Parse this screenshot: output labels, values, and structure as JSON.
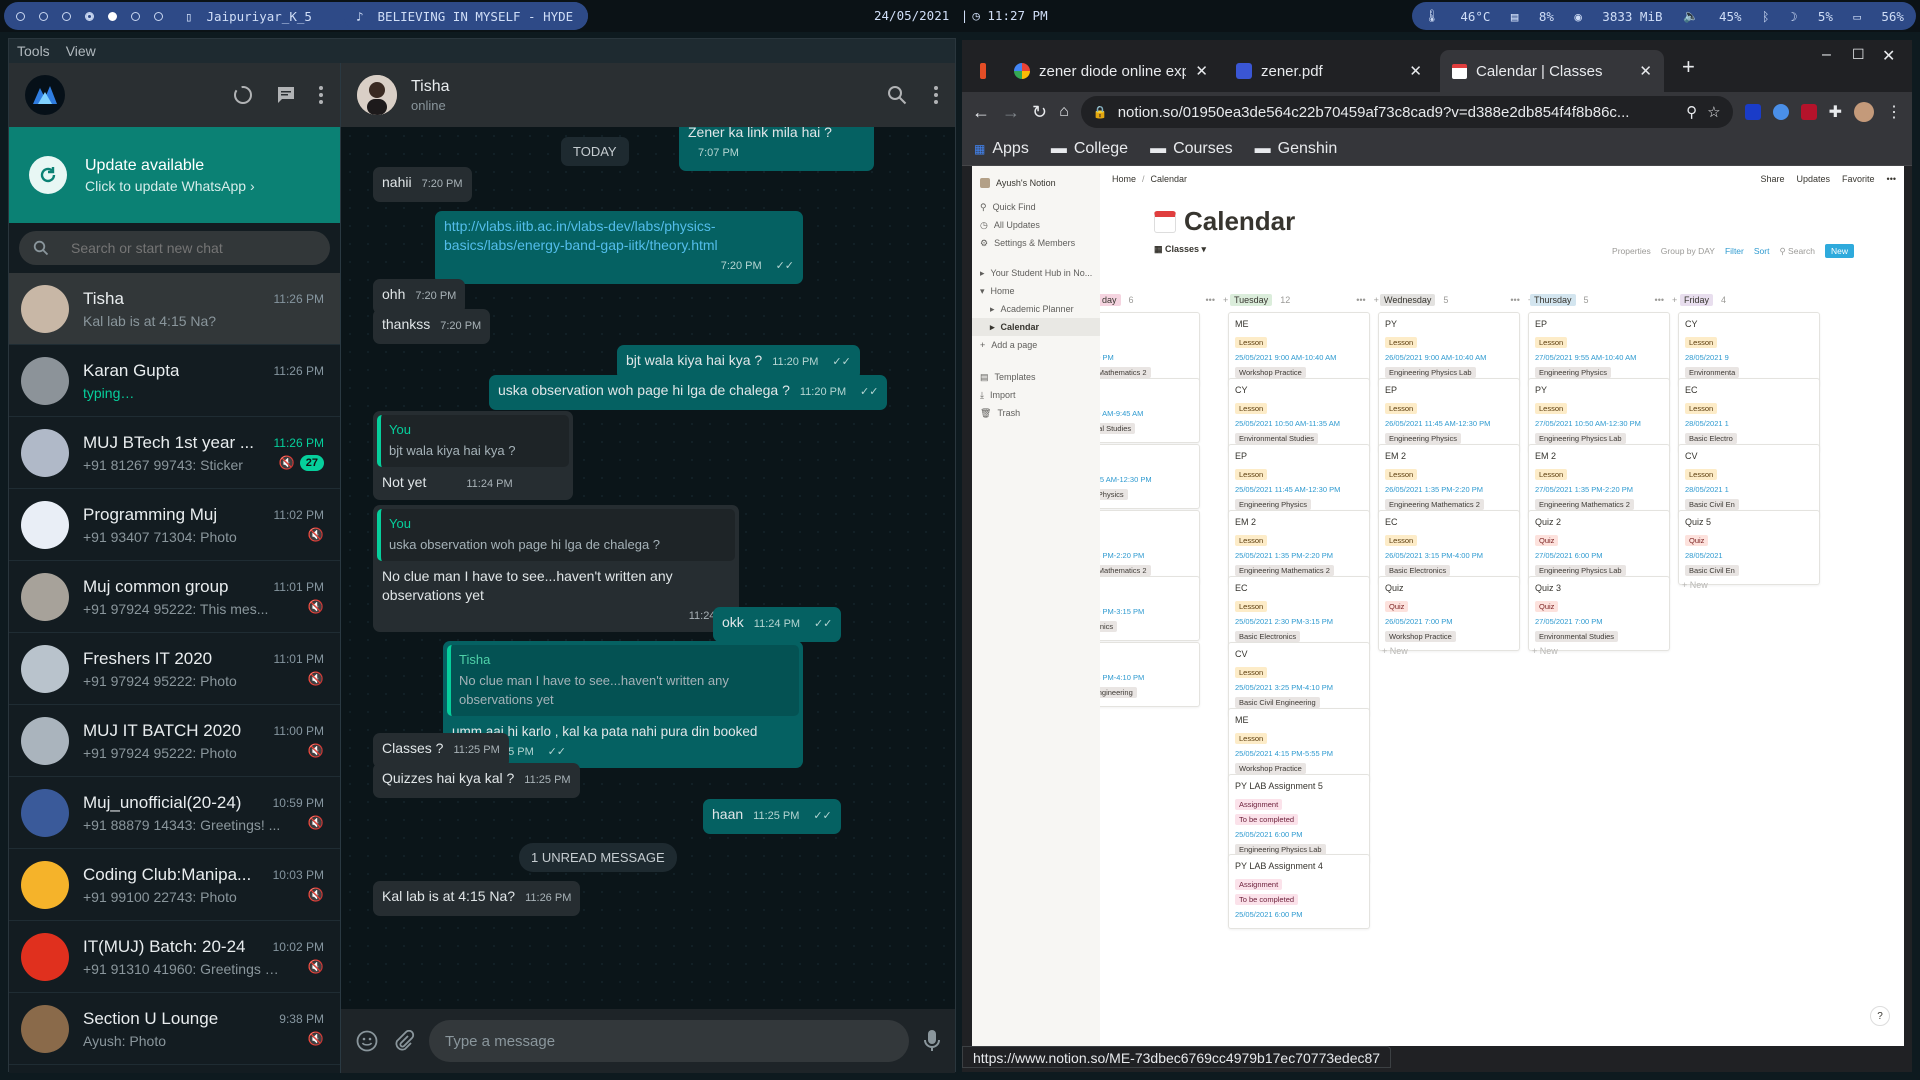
{
  "topbar": {
    "workspace_window": "Jaipuriyar_K_5",
    "now_playing": "BELIEVING IN MYSELF - HYDE",
    "date": "24/05/2021",
    "time": "11:27 PM",
    "temp": "46°C",
    "cpu": "8%",
    "mem": "3833 MiB",
    "volume": "45%",
    "brightness": "5%",
    "battery": "56%"
  },
  "whatsapp": {
    "menu": [
      "Tools",
      "View"
    ],
    "update": {
      "title": "Update available",
      "subtitle": "Click to update WhatsApp ›"
    },
    "search_placeholder": "Search or start new chat",
    "chats": [
      {
        "name": "Tisha",
        "time": "11:26 PM",
        "msg": "Kal lab is at 4:15 Na?",
        "active": true
      },
      {
        "name": "Karan Gupta",
        "time": "11:26 PM",
        "msg": "typing…",
        "typing": true
      },
      {
        "name": "MUJ BTech 1st year ...",
        "time": "11:26 PM",
        "msg": "+91 81267 99743: Sticker",
        "badge": "27"
      },
      {
        "name": "Programming Muj",
        "time": "11:02 PM",
        "msg": "+91 93407 71304: Photo"
      },
      {
        "name": "Muj common group",
        "time": "11:01 PM",
        "msg": "+91 97924 95222: This mes..."
      },
      {
        "name": "Freshers IT 2020",
        "time": "11:01 PM",
        "msg": "+91 97924 95222: Photo"
      },
      {
        "name": "MUJ IT BATCH 2020",
        "time": "11:00 PM",
        "msg": "+91 97924 95222: Photo"
      },
      {
        "name": "Muj_unofficial(20-24)",
        "time": "10:59 PM",
        "msg": "+91 88879 14343: Greetings! ..."
      },
      {
        "name": "Coding Club:Manipa...",
        "time": "10:03 PM",
        "msg": "+91 99100 22743: Photo"
      },
      {
        "name": "IT(MUJ) Batch: 20-24",
        "time": "10:02 PM",
        "msg": "+91 91310 41960: Greetings M..."
      },
      {
        "name": "Section U Lounge",
        "time": "9:38 PM",
        "msg": "Ayush: Photo"
      }
    ],
    "conversation": {
      "name": "Tisha",
      "status": "online",
      "top_partial": "Zener ka link mila hai ?",
      "top_partial_time": "7:07 PM",
      "today": "TODAY",
      "m1": {
        "text": "nahii",
        "time": "7:20 PM"
      },
      "m2": {
        "text": "http://vlabs.iitb.ac.in/vlabs-dev/labs/physics-basics/labs/energy-band-gap-iitk/theory.html",
        "time": "7:20 PM"
      },
      "m3": {
        "text": "ohh",
        "time": "7:20 PM"
      },
      "m4": {
        "text": "thankss",
        "time": "7:20 PM"
      },
      "m5": {
        "text": "bjt wala kiya hai kya ?",
        "time": "11:20 PM"
      },
      "m6": {
        "text": "uska observation woh page hi lga de chalega ?",
        "time": "11:20 PM"
      },
      "m7": {
        "quote_name": "You",
        "quote_text": "bjt wala kiya hai kya ?",
        "text": "Not yet",
        "time": "11:24 PM"
      },
      "m8": {
        "quote_name": "You",
        "quote_text": "uska observation woh page hi lga de chalega ?",
        "text": "No clue man I have to see...haven't written any observations yet",
        "time": "11:24 PM"
      },
      "m9": {
        "text": "okk",
        "time": "11:24 PM"
      },
      "m10": {
        "quote_name": "Tisha",
        "quote_text": "No clue man I have to see...haven't written any observations yet",
        "text": "umm aaj hi karlo , kal ka pata nahi pura din booked hain",
        "time": "11:25 PM"
      },
      "m11": {
        "text": "Classes ?",
        "time": "11:25 PM"
      },
      "m12": {
        "text": "Quizzes hai kya kal ?",
        "time": "11:25 PM"
      },
      "m13": {
        "text": "haan",
        "time": "11:25 PM"
      },
      "unread": "1 UNREAD MESSAGE",
      "m14": {
        "text": "Kal lab is at 4:15 Na?",
        "time": "11:26 PM"
      },
      "input_placeholder": "Type a message"
    }
  },
  "browser": {
    "tabs": [
      "zener diode online exper",
      "zener.pdf",
      "Calendar | Classes"
    ],
    "url": "notion.so/01950ea3de564c22b70459af73c8cad9?v=d388e2db854f4f8b86c...",
    "bookmarks": [
      "Apps",
      "College",
      "Courses",
      "Genshin"
    ],
    "status_url": "https://www.notion.so/ME-73dbec6769cc4979b17ec70773edec87"
  },
  "notion": {
    "workspace": "Ayush's Notion",
    "side_items": [
      "Quick Find",
      "All Updates",
      "Settings & Members"
    ],
    "pages": [
      "Your Student Hub in No...",
      "Home",
      "Academic Planner",
      "Calendar",
      "Add a page"
    ],
    "bottom": [
      "Templates",
      "Import",
      "Trash"
    ],
    "breadcrumb": [
      "Home",
      "Calendar"
    ],
    "actions": [
      "Share",
      "Updates",
      "Favorite"
    ],
    "title": "Calendar",
    "view": "Classes",
    "controls": [
      "Properties",
      "Group by DAY",
      "Filter",
      "Sort",
      "Search",
      "New"
    ],
    "columns": [
      {
        "label": "day",
        "count": "6",
        "color": "#f5d4e0"
      },
      {
        "label": "Tuesday",
        "count": "12",
        "color": "#dbeddb"
      },
      {
        "label": "Wednesday",
        "count": "5",
        "color": "#e3e2e0"
      },
      {
        "label": "Thursday",
        "count": "5",
        "color": "#d3e5ef"
      },
      {
        "label": "Friday",
        "count": "4",
        "color": "#e8deee"
      }
    ],
    "col0": [
      {
        "t": "2",
        "tag": "Quiz",
        "date": "/2021 7:30 PM",
        "sub": "ineering Mathematics 2"
      },
      {
        "t": "",
        "tag": "Lesson",
        "date": "/2021 9:00 AM-9:45 AM",
        "sub": "ironmental Studies"
      },
      {
        "t": "",
        "tag": "Lesson",
        "date": "/2021 11:45 AM-12:30 PM",
        "sub": "ineering Physics"
      },
      {
        "t": "2",
        "tag": "Lesson",
        "date": "/2021 1:35 PM-2:20 PM",
        "sub": "ineering Mathematics 2"
      },
      {
        "t": "",
        "tag": "Lesson",
        "date": "/2021 2:30 PM-3:15 PM",
        "sub": "ic Electronics"
      },
      {
        "t": "",
        "tag": "Lesson",
        "date": "/2021 3:25 PM-4:10 PM",
        "sub": "ic Civil Engineering"
      }
    ],
    "col1": [
      {
        "t": "ME",
        "tag": "Lesson",
        "date": "25/05/2021 9:00 AM-10:40 AM",
        "sub": "Workshop Practice"
      },
      {
        "t": "CY",
        "tag": "Lesson",
        "date": "25/05/2021 10:50 AM-11:35 AM",
        "sub": "Environmental Studies"
      },
      {
        "t": "EP",
        "tag": "Lesson",
        "date": "25/05/2021 11:45 AM-12:30 PM",
        "sub": "Engineering Physics"
      },
      {
        "t": "EM 2",
        "tag": "Lesson",
        "date": "25/05/2021 1:35 PM-2:20 PM",
        "sub": "Engineering Mathematics 2"
      },
      {
        "t": "EC",
        "tag": "Lesson",
        "date": "25/05/2021 2:30 PM-3:15 PM",
        "sub": "Basic Electronics"
      },
      {
        "t": "CV",
        "tag": "Lesson",
        "date": "25/05/2021 3:25 PM-4:10 PM",
        "sub": "Basic Civil Engineering"
      },
      {
        "t": "ME",
        "tag": "Lesson",
        "date": "25/05/2021 4:15 PM-5:55 PM",
        "sub": "Workshop Practice"
      },
      {
        "t": "PY LAB Assignment 5",
        "tag": "Assignment",
        "tag2": "To be completed",
        "date": "25/05/2021 6:00 PM",
        "sub": "Engineering Physics Lab"
      },
      {
        "t": "PY LAB Assignment 4",
        "tag": "Assignment",
        "tag2": "To be completed",
        "date": "25/05/2021 6:00 PM",
        "sub": ""
      }
    ],
    "col2": [
      {
        "t": "PY",
        "tag": "Lesson",
        "date": "26/05/2021 9:00 AM-10:40 AM",
        "sub": "Engineering Physics Lab"
      },
      {
        "t": "EP",
        "tag": "Lesson",
        "date": "26/05/2021 11:45 AM-12:30 PM",
        "sub": "Engineering Physics"
      },
      {
        "t": "EM 2",
        "tag": "Lesson",
        "date": "26/05/2021 1:35 PM-2:20 PM",
        "sub": "Engineering Mathematics 2"
      },
      {
        "t": "EC",
        "tag": "Lesson",
        "date": "26/05/2021 3:15 PM-4:00 PM",
        "sub": "Basic Electronics"
      },
      {
        "t": "Quiz",
        "tag": "Quiz",
        "date": "26/05/2021 7:00 PM",
        "sub": "Workshop Practice"
      }
    ],
    "col3": [
      {
        "t": "EP",
        "tag": "Lesson",
        "date": "27/05/2021 9:55 AM-10:40 AM",
        "sub": "Engineering Physics"
      },
      {
        "t": "PY",
        "tag": "Lesson",
        "date": "27/05/2021 10:50 AM-12:30 PM",
        "sub": "Engineering Physics Lab"
      },
      {
        "t": "EM 2",
        "tag": "Lesson",
        "date": "27/05/2021 1:35 PM-2:20 PM",
        "sub": "Engineering Mathematics 2"
      },
      {
        "t": "Quiz 2",
        "tag": "Quiz",
        "date": "27/05/2021 6:00 PM",
        "sub": "Engineering Physics Lab"
      },
      {
        "t": "Quiz 3",
        "tag": "Quiz",
        "date": "27/05/2021 7:00 PM",
        "sub": "Environmental Studies"
      }
    ],
    "col4": [
      {
        "t": "CY",
        "tag": "Lesson",
        "date": "28/05/2021 9",
        "sub": "Environmenta"
      },
      {
        "t": "EC",
        "tag": "Lesson",
        "date": "28/05/2021 1",
        "sub": "Basic Electro"
      },
      {
        "t": "CV",
        "tag": "Lesson",
        "date": "28/05/2021 1",
        "sub": "Basic Civil En"
      },
      {
        "t": "Quiz 5",
        "tag": "Quiz",
        "date": "28/05/2021",
        "sub": "Basic Civil En"
      }
    ],
    "new_label": "+ New"
  }
}
